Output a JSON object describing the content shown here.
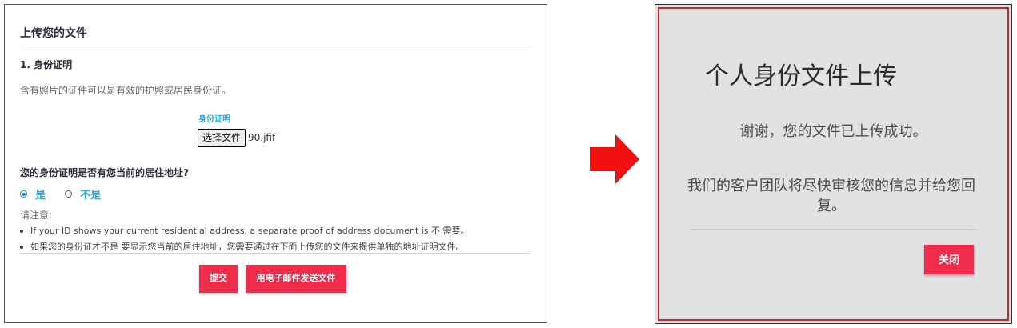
{
  "upload_form": {
    "title": "上传您的文件",
    "section_title": "1. 身份证明",
    "description": "含有照片的证件可以是有效的护照或居民身份证。",
    "upload_label": "身份证明",
    "choose_file_button": "选择文件",
    "selected_file": "90.jfif",
    "address_question": "您的身份证明是否有您当前的居住地址?",
    "options": [
      {
        "label": "是",
        "selected": true
      },
      {
        "label": "不是",
        "selected": false
      }
    ],
    "note_label": "请注意:",
    "notes": [
      "If your ID shows your current residential address, a separate proof of address document is 不 需要。",
      "如果您的身份证才不是 要显示您当前的居住地址，您需要通过在下面上传您的文件来提供单独的地址证明文件。"
    ],
    "submit_button": "提交",
    "email_button": "用电子邮件发送文件"
  },
  "arrow_icon": "right-arrow-icon",
  "result_modal": {
    "title": "个人身份文件上传",
    "success_message": "谢谢，您的文件已上传成功。",
    "info_message": "我们的客户团队将尽快审核您的信息并给您回复。",
    "close_button": "关闭"
  },
  "colors": {
    "accent": "#f02c4c",
    "link_blue": "#24a9d8",
    "frame_red": "#c9262f",
    "modal_bg": "#e2e2e2"
  }
}
